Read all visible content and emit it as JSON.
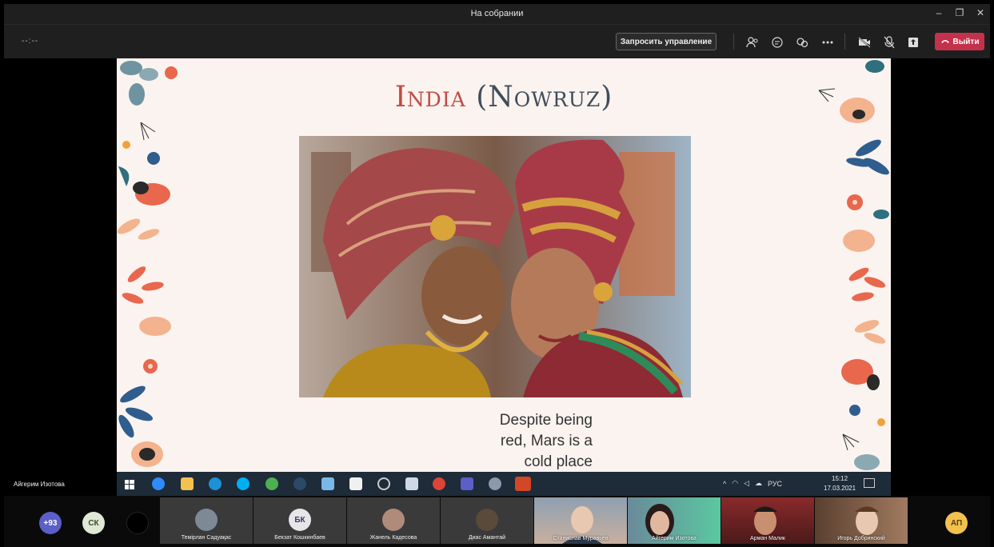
{
  "window": {
    "title": "На собрании",
    "minimize": "–",
    "maximize": "❐",
    "close": "✕"
  },
  "toolbar": {
    "timer": "--:--",
    "request_control": "Запросить управление",
    "leave": "Выйти",
    "icons": [
      "participants-icon",
      "chat-icon",
      "reactions-icon",
      "more-icon",
      "camera-off-icon",
      "mic-off-icon",
      "share-icon"
    ]
  },
  "slide": {
    "title_part1": "India",
    "title_part2": "(Nowruz)",
    "caption_line1": "Despite being",
    "caption_line2": "red, Mars is a",
    "caption_line3": "cold place"
  },
  "presenter_name": "Айгерим Изотова",
  "taskbar": {
    "tray_lang": "РУС",
    "time": "15:12",
    "date": "17.03.2021"
  },
  "participants": {
    "overflow_count": "+93",
    "sk_initials": "СК",
    "ap_initials": "АП",
    "tiles": [
      {
        "name": "Темірлан Садуақас"
      },
      {
        "name": "Бекзат Кошкинбаев",
        "initials": "БК"
      },
      {
        "name": "Жанель Кадесова"
      },
      {
        "name": "Диас Амантай"
      },
      {
        "name": "Станислав Муравьев"
      },
      {
        "name": "Айгерим Изотова"
      },
      {
        "name": "Арман Малик"
      },
      {
        "name": "Игорь Добринский"
      }
    ]
  },
  "colors": {
    "leave": "#c4314b",
    "title_red": "#c24a44",
    "title_navy": "#3f4d5a",
    "overflow_badge": "#5b5fc7"
  }
}
